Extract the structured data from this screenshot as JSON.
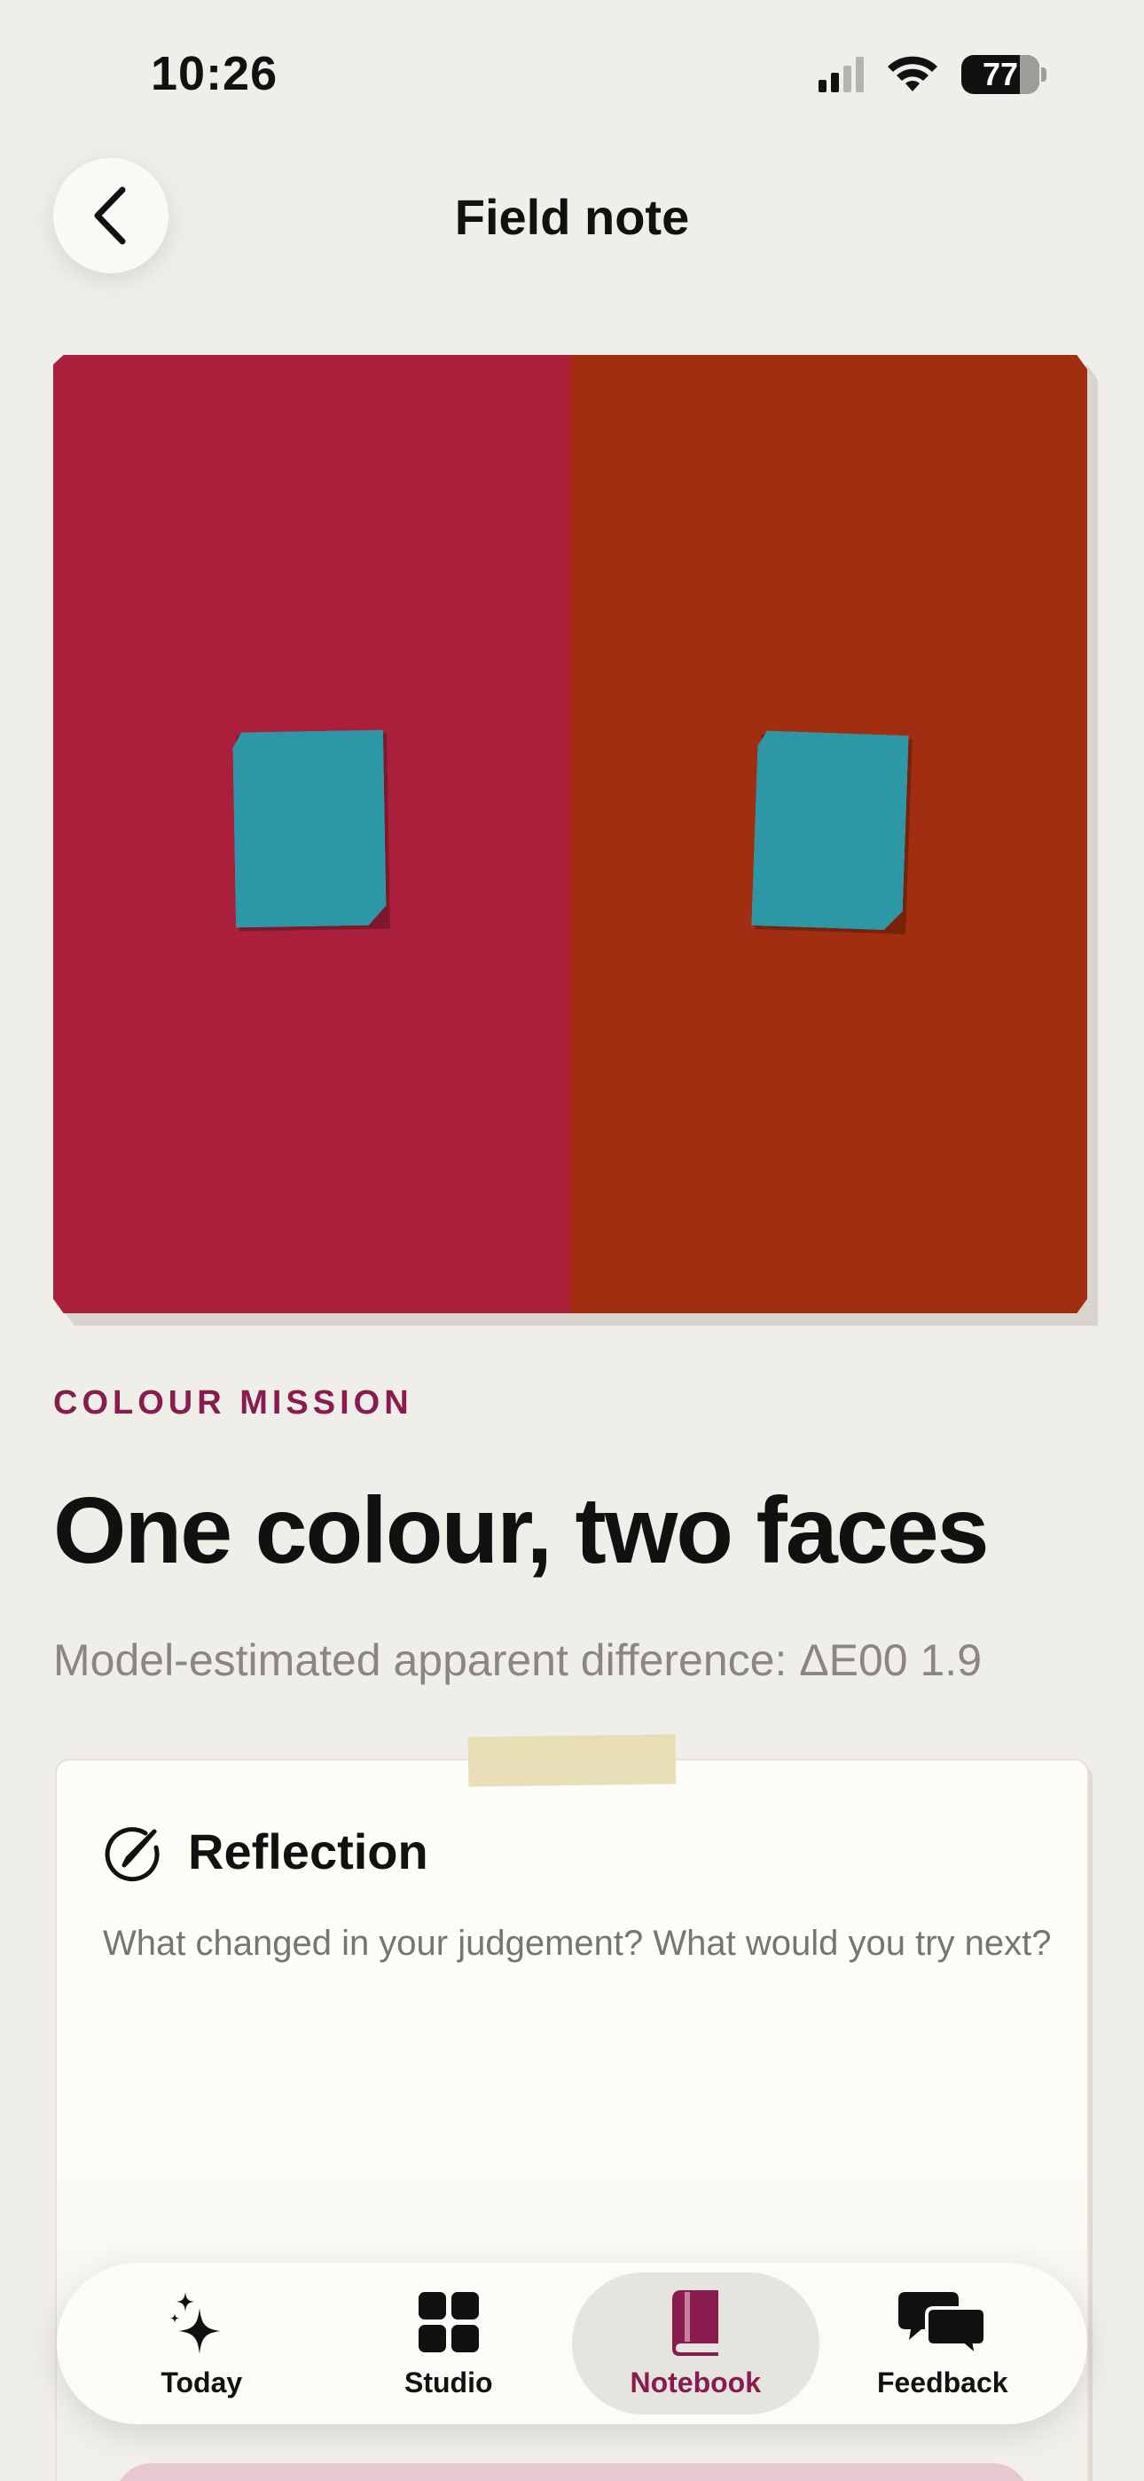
{
  "status_bar": {
    "time": "10:26",
    "battery": "77"
  },
  "header": {
    "title": "Field note"
  },
  "colors": {
    "left_surround": "#aa1f3c",
    "right_surround": "#a12e10",
    "swatch": "#2e97a6",
    "accent": "#8a1b4e"
  },
  "mission": {
    "eyebrow": "COLOUR MISSION",
    "title": "One colour, two faces",
    "subtitle": "Model-estimated apparent difference: ΔE00 1.9"
  },
  "reflection": {
    "title": "Reflection",
    "placeholder": "What changed in your judgement? What would you try next?"
  },
  "tabbar": {
    "tabs": [
      {
        "label": "Today",
        "icon": "sparkles-icon"
      },
      {
        "label": "Studio",
        "icon": "grid-icon"
      },
      {
        "label": "Notebook",
        "icon": "book-icon",
        "active": true
      },
      {
        "label": "Feedback",
        "icon": "chat-bubbles-icon"
      }
    ]
  }
}
